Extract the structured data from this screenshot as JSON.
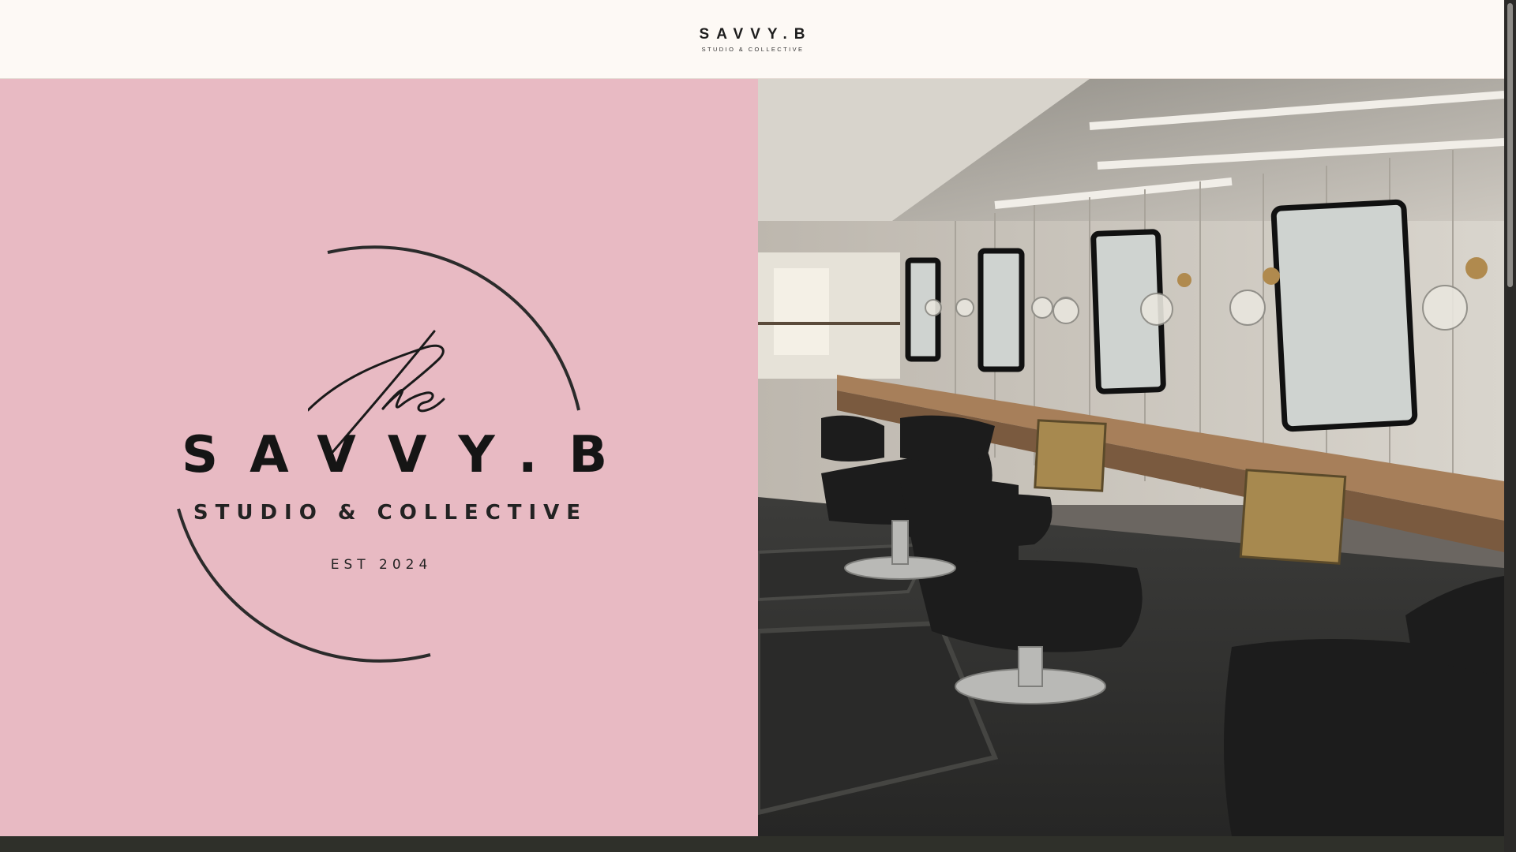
{
  "header": {
    "logo_title": "SAVVY.B",
    "logo_subtitle": "STUDIO & COLLECTIVE"
  },
  "hero": {
    "emblem": {
      "script_word": "the",
      "title": "SAVVY.B",
      "subtitle": "STUDIO & COLLECTIVE",
      "est": "EST 2024"
    },
    "photo_subject": "salon-interior-photo"
  },
  "colors": {
    "header_bg": "#fdf9f5",
    "hero_pink": "#e8bac3",
    "ink": "#151515",
    "footer": "#2f302a",
    "brass": "#b08a4e"
  }
}
